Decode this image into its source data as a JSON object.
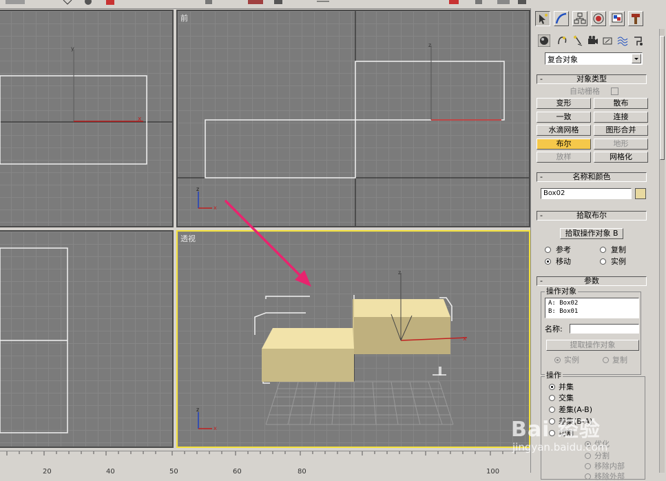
{
  "viewports": {
    "front_label": "前",
    "perspective_label": "透视"
  },
  "panel": {
    "category_select": "复合对象",
    "object_type": {
      "title": "对象类型",
      "collapse": "-",
      "autogrid_label": "自动栅格",
      "buttons": [
        "变形",
        "散布",
        "一致",
        "连接",
        "水滴网格",
        "图形合并",
        "布尔",
        "地形",
        "放样",
        "网格化"
      ]
    },
    "name_color": {
      "title": "名称和颜色",
      "collapse": "-",
      "name_value": "Box02",
      "color": "#e8d9a0"
    },
    "pick_boolean": {
      "title": "拾取布尔",
      "collapse": "-",
      "pick_button": "拾取操作对象 B",
      "options": [
        "参考",
        "复制",
        "移动",
        "实例"
      ]
    },
    "parameters": {
      "title": "参数",
      "collapse": "-",
      "operands_group": "操作对象",
      "operands": [
        "A:  Box02",
        "B:  Box01"
      ],
      "name_label": "名称:",
      "extract_button": "提取操作对象",
      "extract_options": [
        "实例",
        "复制"
      ],
      "operation_group": "操作",
      "operations": [
        "并集",
        "交集",
        "差集(A-B)",
        "差集(B-A)",
        "切割",
        "优化",
        "分割",
        "移除内部",
        "移除外部"
      ]
    }
  },
  "ruler": {
    "ticks": [
      "20",
      "40",
      "50",
      "60",
      "80",
      "100"
    ]
  },
  "watermark": {
    "logo": "Bai 经验",
    "url": "jingyan.baidu.com"
  }
}
